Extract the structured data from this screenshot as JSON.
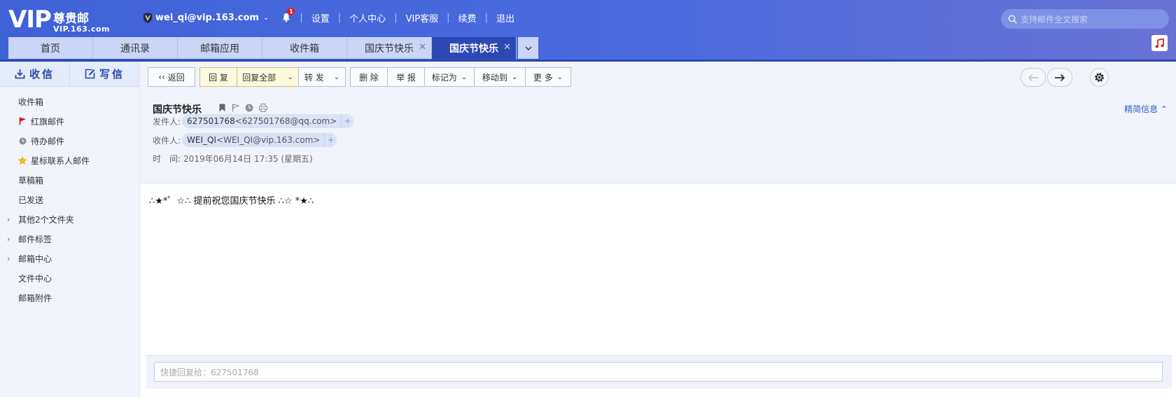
{
  "logo": {
    "vip": "VIP",
    "brand": "尊贵邮",
    "domain": "VIP.163.com"
  },
  "topnav": {
    "account": "wei_qi@vip.163.com",
    "notifications": "1",
    "links": [
      "设置",
      "个人中心",
      "VIP客服",
      "续费",
      "退出"
    ]
  },
  "search": {
    "placeholder": "支持邮件全文搜索"
  },
  "tabs": [
    {
      "label": "首页"
    },
    {
      "label": "通讯录"
    },
    {
      "label": "邮箱应用"
    },
    {
      "label": "收件箱"
    },
    {
      "label": "国庆节快乐",
      "closable": true
    },
    {
      "label": "国庆节快乐",
      "closable": true,
      "active": true
    }
  ],
  "sidebar": {
    "receive": "收信",
    "write": "写信",
    "folders": [
      "收件箱",
      "红旗邮件",
      "待办邮件",
      "星标联系人邮件",
      "草稿箱",
      "已发送",
      "其他2个文件夹",
      "邮件标签",
      "邮箱中心",
      "文件中心",
      "邮箱附件"
    ]
  },
  "toolbar": {
    "back": "返回",
    "reply": "回 复",
    "reply_all": "回复全部",
    "forward": "转 发",
    "delete": "删 除",
    "report": "举 报",
    "mark_as": "标记为",
    "move_to": "移动到",
    "more": "更 多"
  },
  "mail": {
    "subject": "国庆节快乐",
    "simple_info": "精简信息",
    "from_label": "发件人:",
    "from_name": "627501768",
    "from_addr": "<627501768@qq.com>",
    "to_label": "收件人:",
    "to_name": "WEI_QI",
    "to_addr": "<WEI_QI@vip.163.com>",
    "time_label": "时　间:",
    "time_value": "2019年06月14日 17:35 (星期五)",
    "body": "∴★*゜☆∴ 提前祝您国庆节快乐 ∴☆ *★∴"
  },
  "quick_reply": {
    "placeholder": "快捷回复给：627501768"
  },
  "colors": {
    "header": "#4a6ce0",
    "active_tab": "#2b48b3",
    "sidebar_bg": "#f1f4fb"
  }
}
